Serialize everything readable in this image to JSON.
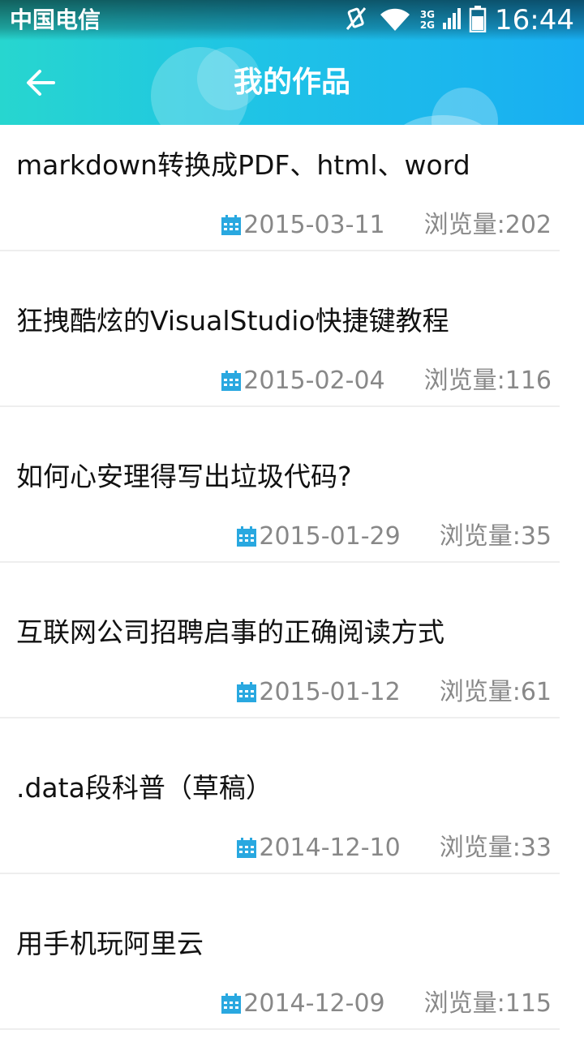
{
  "status_bar": {
    "carrier": "中国电信",
    "network_top": "3G",
    "network_bottom": "2G",
    "time": "16:44",
    "icons": [
      "mute-icon",
      "wifi-icon",
      "signal-icon",
      "battery-icon"
    ]
  },
  "app_bar": {
    "title": "我的作品",
    "back_icon": "arrow-left-icon"
  },
  "colors": {
    "header_start": "#27d6cf",
    "header_end": "#18aef2",
    "calendar_icon": "#29a8e0",
    "meta_text": "#888888"
  },
  "list": [
    {
      "title": "markdown转换成PDF、html、word",
      "date": "2015-03-11",
      "views": "浏览量:202"
    },
    {
      "title": "狂拽酷炫的VisualStudio快捷键教程",
      "date": "2015-02-04",
      "views": "浏览量:116"
    },
    {
      "title": "如何心安理得写出垃圾代码?",
      "date": "2015-01-29",
      "views": "浏览量:35"
    },
    {
      "title": "互联网公司招聘启事的正确阅读方式",
      "date": "2015-01-12",
      "views": "浏览量:61"
    },
    {
      "title": ".data段科普（草稿）",
      "date": "2014-12-10",
      "views": "浏览量:33"
    },
    {
      "title": "用手机玩阿里云",
      "date": "2014-12-09",
      "views": "浏览量:115"
    }
  ]
}
